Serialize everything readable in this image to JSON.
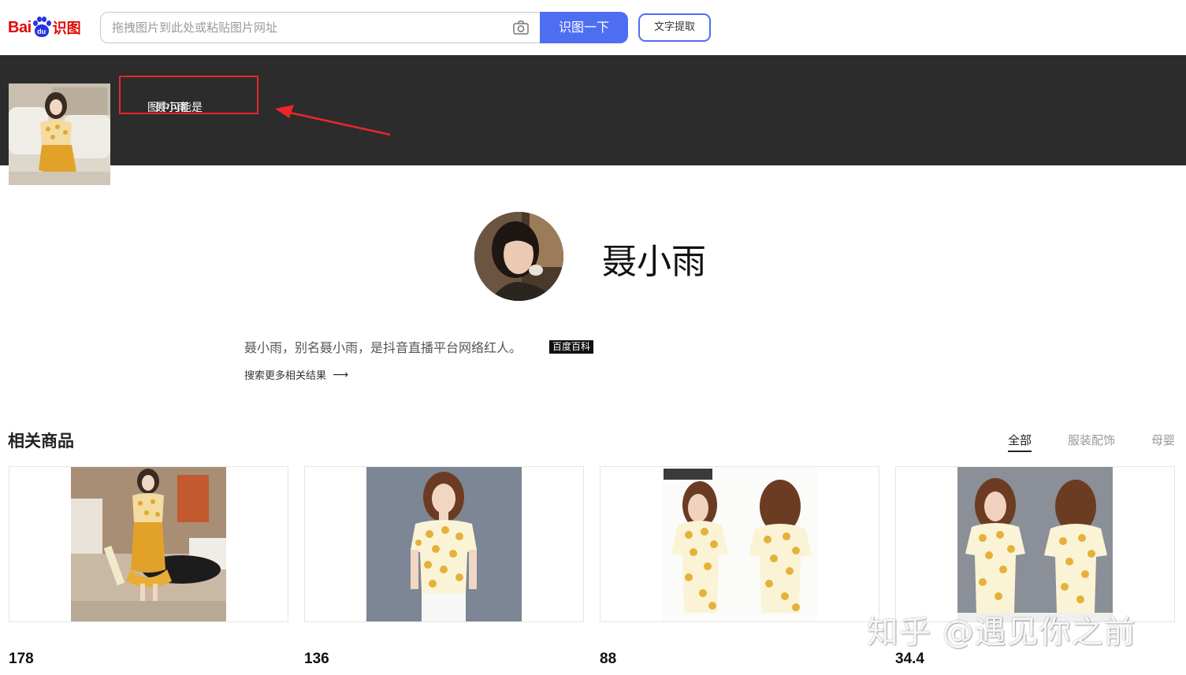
{
  "header": {
    "logo_text_bai": "Bai",
    "logo_text_du": "du",
    "logo_text_shitu": "识图",
    "search_placeholder": "拖拽图片到此处或粘贴图片网址",
    "search_button": "识图一下",
    "ocr_button": "文字提取",
    "camera_icon": "camera-icon"
  },
  "result": {
    "maybe_label": "图中可能是",
    "maybe_name": "聂小雨"
  },
  "person": {
    "name": "聂小雨",
    "description": "聂小雨，别名聂小雨，是抖音直播平台网络红人。",
    "source_badge": "百度百科",
    "more_link": "搜索更多相关结果",
    "more_arrow": "⟶"
  },
  "products": {
    "title": "相关商品",
    "tabs": [
      "全部",
      "服装配饰",
      "母婴"
    ],
    "active_tab": 0,
    "items": [
      {
        "price": "178"
      },
      {
        "price": "136"
      },
      {
        "price": "88"
      },
      {
        "price": "34.4"
      }
    ]
  },
  "watermark": "知乎 @遇见你之前",
  "colors": {
    "brand_red": "#e10601",
    "brand_blue": "#4e6ef2",
    "banner_bg": "#2c2c2c",
    "highlight_red": "#e8262c"
  }
}
